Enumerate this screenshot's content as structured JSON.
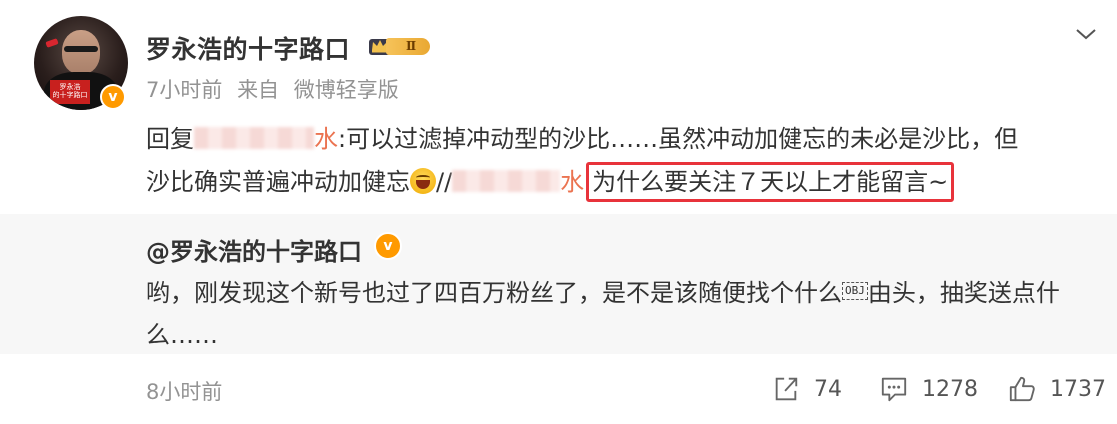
{
  "post": {
    "author": "罗永浩的十字路口",
    "avatar_label": "罗永浩\n的十字路口",
    "vip_level": "Ⅱ",
    "verified_mark": "v",
    "time": "7小时前",
    "source_prefix": "来自",
    "source": "微博轻享版",
    "text": {
      "reply_prefix": "回复",
      "reply_name_tail": "水",
      "line1_rest": ":可以过滤掉冲动型的沙比……虽然冲动加健忘的未必是沙比，但",
      "line2_start": "沙比确实普遍冲动加健忘",
      "emoji_icon": "laughing-face",
      "separator": "//",
      "quoted_name_tail": "水",
      "highlight": "为什么要关注７天以上才能留言~"
    }
  },
  "repost": {
    "author": "@罗永浩的十字路口",
    "verified_mark": "v",
    "line1_before": "哟，刚发现这个新号也过了四百万粉丝了，是不是该随便找个什么",
    "obj_glyph": "OBJ",
    "line1_after": "由头，抽奖送点什",
    "line2": "么……"
  },
  "footer": {
    "time": "8小时前",
    "share_icon": "share-icon",
    "share_count": "74",
    "comment_icon": "comment-icon",
    "comment_count": "1278",
    "like_icon": "thumbs-up-icon",
    "like_count": "1737"
  },
  "colors": {
    "accent_orange": "#eb7350",
    "highlight_red": "#e8333b",
    "verified_orange": "#ff9a00",
    "muted_gray": "#939393",
    "quote_bg": "#f7f7f7"
  }
}
